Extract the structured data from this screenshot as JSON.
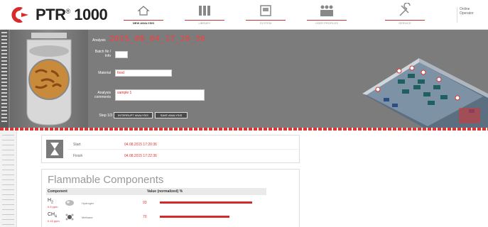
{
  "header": {
    "logo_text": "PTR",
    "logo_trademark": "®",
    "logo_number": "1000",
    "nav": [
      {
        "label": "NEW ANALYSIS",
        "icon": "home-icon"
      },
      {
        "label": "LIBRARY",
        "icon": "library-icon"
      },
      {
        "label": "SYSTEM",
        "icon": "system-icon"
      },
      {
        "label": "USER PROFILES",
        "icon": "users-icon"
      },
      {
        "label": "SERVICE",
        "icon": "service-icon"
      }
    ],
    "user": {
      "line1": "Online",
      "line2": "Operator"
    }
  },
  "analysis": {
    "label": "Analysis",
    "value": "2015_08_04_17_20_36",
    "batch_label": "Batch Nr / Info",
    "batch_value": "",
    "material_label": "Material",
    "material_value": "food",
    "comment_label": "Analysis comments",
    "comment_value": "sample 1",
    "step_label": "Step 1/3",
    "btn_interrupt": "INTERRUPT ANALYSIS",
    "btn_save": "SAVE ANALYSIS"
  },
  "status": {
    "row1_label": "Start",
    "row1_value": "04.08.2015 17:20:36",
    "row2_label": "Finish",
    "row2_value": "04.08.2015 17:22:36"
  },
  "flammable": {
    "title": "Flammable Components",
    "col_component": "Component",
    "col_value": "Value (normalized) %",
    "rows": [
      {
        "formula": "H",
        "sub": "2",
        "ppm": "0.5 ppm",
        "name": "Hydrogen",
        "value": "93",
        "fraction": 0.93,
        "icon": "hydrogen-icon"
      },
      {
        "formula": "CH",
        "sub": "4",
        "ppm": "0.15 ppm",
        "name": "Methane",
        "value": "70",
        "fraction": 0.7,
        "icon": "methane-icon"
      }
    ]
  },
  "colors": {
    "accent": "#d33333",
    "panel": "#7c7c7c"
  }
}
